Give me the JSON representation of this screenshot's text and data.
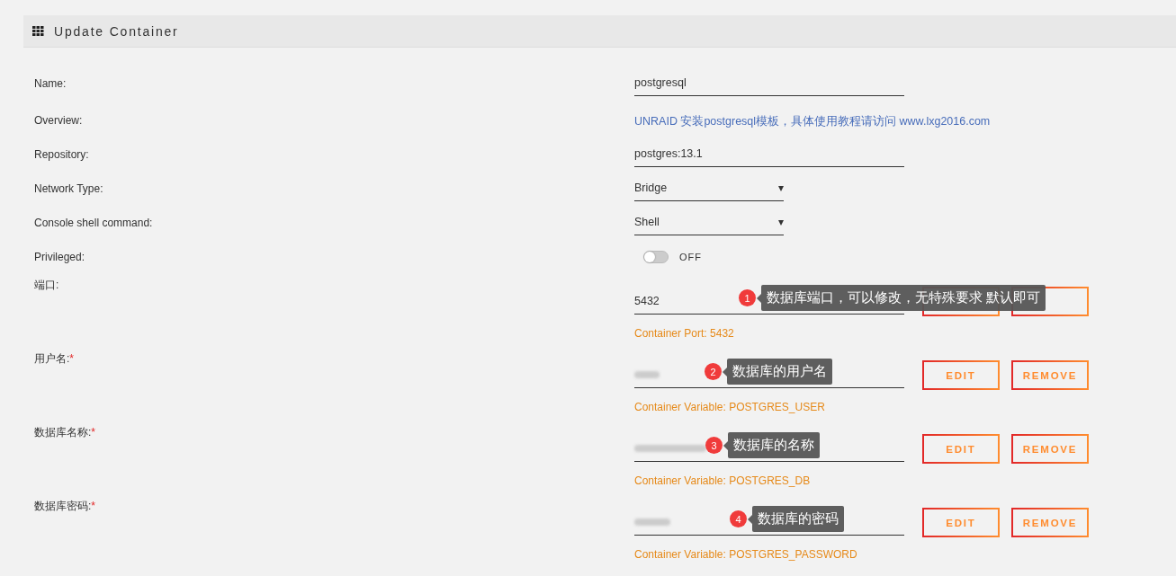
{
  "header": {
    "title": "Update Container"
  },
  "settings": [
    {
      "label": "Name:",
      "kind": "text",
      "value": "postgresql"
    },
    {
      "label": "Overview:",
      "kind": "info",
      "value": "UNRAID 安装postgresql模板，具体使用教程请访问 www.lxg2016.com"
    },
    {
      "label": "Repository:",
      "kind": "text",
      "value": "postgres:13.1"
    },
    {
      "label": "Network Type:",
      "kind": "select",
      "value": "Bridge",
      "caret": "▾"
    },
    {
      "label": "Console shell command:",
      "kind": "select",
      "value": "Shell",
      "caret": "▾"
    },
    {
      "label": "Privileged:",
      "kind": "toggle",
      "on": false,
      "value": "OFF"
    }
  ],
  "variables": [
    {
      "label": "端口:",
      "value": "5432",
      "help": "Container Port: 5432",
      "callout": {
        "number": "1",
        "text": "数据库端口，可以修改，无特殊要求 默认即可"
      }
    },
    {
      "label": "用户名:",
      "required_mark": "*",
      "help": "Container Variable: POSTGRES_USER",
      "buttons": [
        "EDIT",
        "REMOVE"
      ],
      "callout": {
        "number": "2",
        "text": "数据库的用户名"
      }
    },
    {
      "label": "数据库名称:",
      "required_mark": "*",
      "help": "Container Variable: POSTGRES_DB",
      "buttons": [
        "EDIT",
        "REMOVE"
      ],
      "callout": {
        "number": "3",
        "text": "数据库的名称"
      }
    },
    {
      "label": "数据库密码:",
      "required_mark": "*",
      "help": "Container Variable: POSTGRES_PASSWORD",
      "buttons": [
        "EDIT",
        "REMOVE"
      ],
      "callout": {
        "number": "4",
        "text": "数据库的密码"
      }
    }
  ]
}
